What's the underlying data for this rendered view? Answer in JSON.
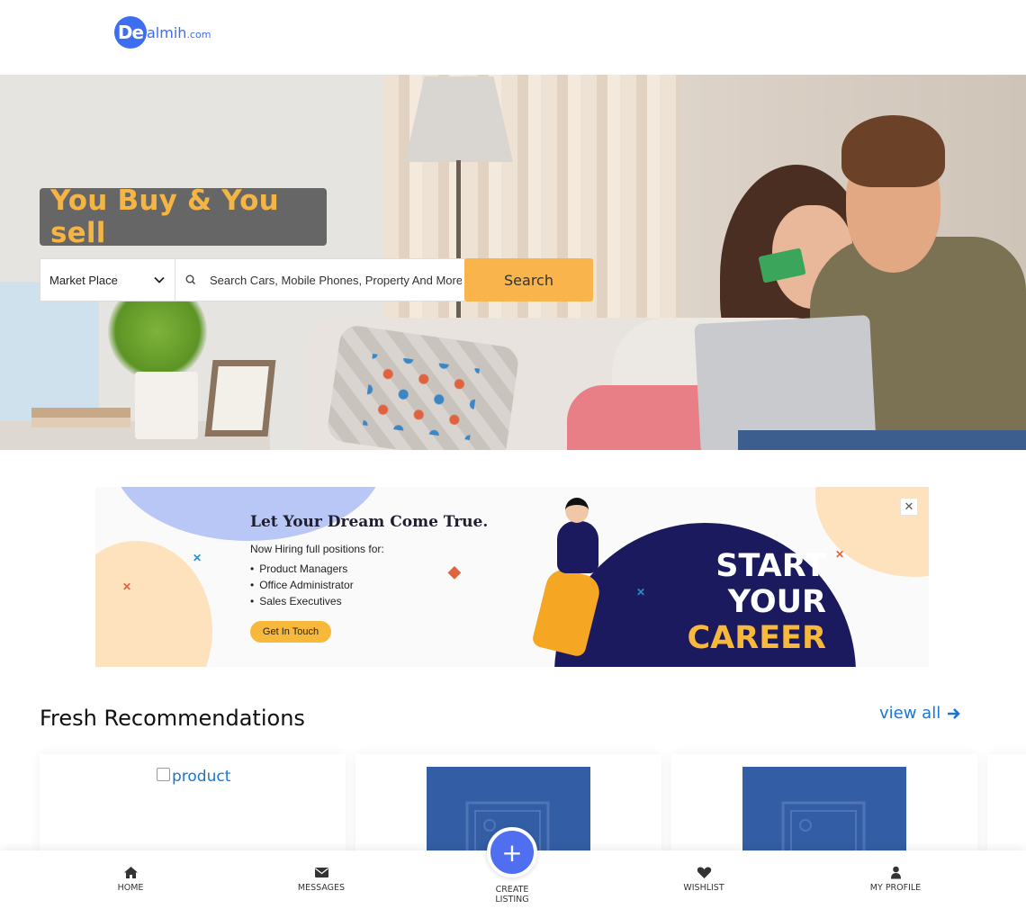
{
  "header": {
    "logo_mark": "De",
    "logo_text": "almih",
    "logo_suffix": ".com"
  },
  "hero": {
    "tagline": "You Buy & You sell",
    "category_select": "Market Place",
    "search_placeholder": "Search Cars, Mobile Phones, Property And More...",
    "search_button": "Search"
  },
  "banner": {
    "headline": "Let Your Dream Come True.",
    "subheading": "Now Hiring full positions for:",
    "positions": [
      "Product Managers",
      "Office Administrator",
      "Sales Executives"
    ],
    "cta": "Get In Touch",
    "big_line1": "START",
    "big_line2": "YOUR",
    "big_line3": "CAREER",
    "close": "✕"
  },
  "recommendations": {
    "title": "Fresh Recommendations",
    "view_all": "view all",
    "broken_image_alt": "product"
  },
  "bottom_nav": {
    "home": "HOME",
    "messages": "MESSAGES",
    "create_line1": "CREATE",
    "create_line2": "LISTING",
    "create_symbol": "+",
    "wishlist": "WISHLIST",
    "profile": "MY PROFILE"
  },
  "colors": {
    "brand_blue": "#3e6ef0",
    "search_button": "#f9b44c",
    "tagline": "#f5b545",
    "link": "#1976d2",
    "banner_dark": "#1c1a5e"
  }
}
